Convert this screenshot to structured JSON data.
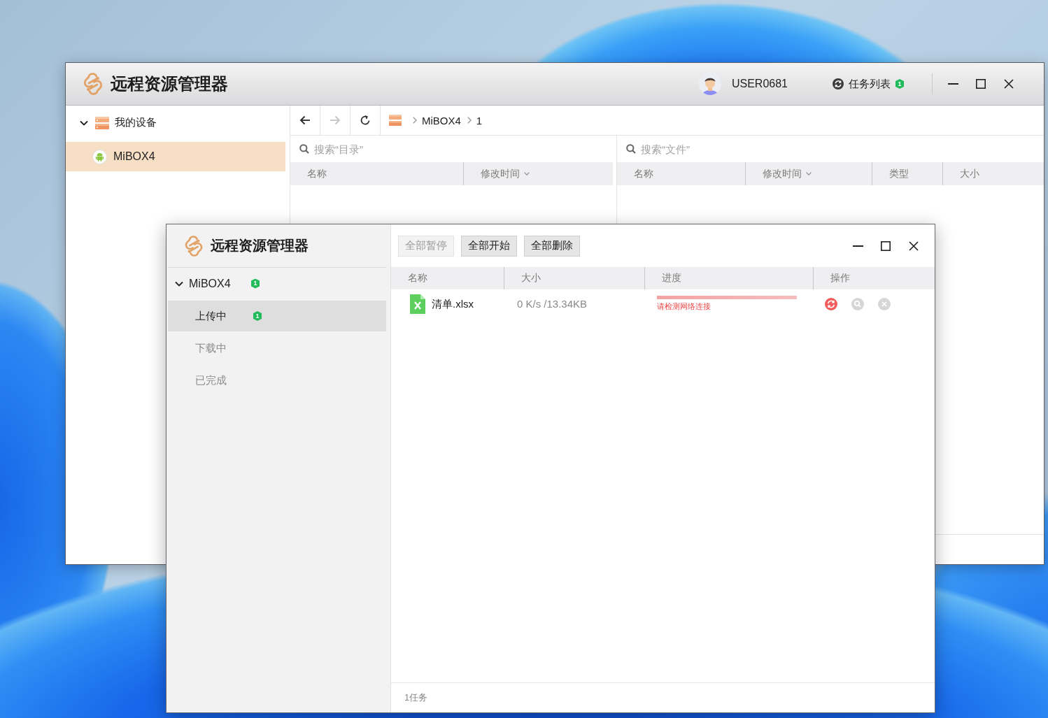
{
  "main_window": {
    "title": "远程资源管理器",
    "user": {
      "name": "USER0681"
    },
    "task_list": {
      "label": "任务列表",
      "badge": "1"
    },
    "sidebar": {
      "items": [
        {
          "kind": "group",
          "label": "我的设备",
          "expanded": true,
          "selected": false,
          "children": [
            {
              "kind": "device",
              "label": "MiBOX4",
              "selected": true
            }
          ]
        }
      ]
    },
    "toolbar": {
      "nav": [
        {
          "kind": "back",
          "disabled": false
        },
        {
          "kind": "forward",
          "disabled": true
        },
        {
          "kind": "refresh",
          "disabled": false
        }
      ],
      "breadcrumb": [
        "MiBOX4",
        "1"
      ]
    },
    "directory_pane": {
      "search": {
        "placeholder": "搜索“目录”"
      },
      "columns": [
        {
          "label": "名称",
          "sortable": false
        },
        {
          "label": "修改时间",
          "sortable": true
        }
      ]
    },
    "file_pane": {
      "search": {
        "placeholder": "搜索“文件”"
      },
      "columns": [
        {
          "label": "名称",
          "sortable": false
        },
        {
          "label": "修改时间",
          "sortable": true
        },
        {
          "label": "类型",
          "sortable": false
        },
        {
          "label": "大小",
          "sortable": false
        }
      ]
    }
  },
  "task_window": {
    "title": "远程资源管理器",
    "sidebar": {
      "items": [
        {
          "label": "MiBOX4",
          "expanded": true,
          "selected": false,
          "badge": "1",
          "children": [
            {
              "label": "上传中",
              "selected": true,
              "badge": "1"
            },
            {
              "label": "下载中",
              "selected": false
            },
            {
              "label": "已完成",
              "selected": false
            }
          ]
        }
      ]
    },
    "buttons": [
      {
        "label": "全部暂停",
        "disabled": true
      },
      {
        "label": "全部开始",
        "disabled": false
      },
      {
        "label": "全部删除",
        "disabled": false
      }
    ],
    "table": {
      "columns": [
        {
          "label": "名称"
        },
        {
          "label": "大小"
        },
        {
          "label": "进度"
        },
        {
          "label": "操作"
        }
      ],
      "rows": [
        {
          "name": "清单.xlsx",
          "size": "0 K/s /13.34KB",
          "level": 1,
          "error": true,
          "message": "请检测网络连接",
          "actions": [
            {
              "kind": "retry",
              "disabled": false
            },
            {
              "kind": "search",
              "disabled": true
            },
            {
              "kind": "delete",
              "disabled": true
            }
          ]
        }
      ]
    },
    "status_bar": {
      "text": "1任务"
    }
  }
}
